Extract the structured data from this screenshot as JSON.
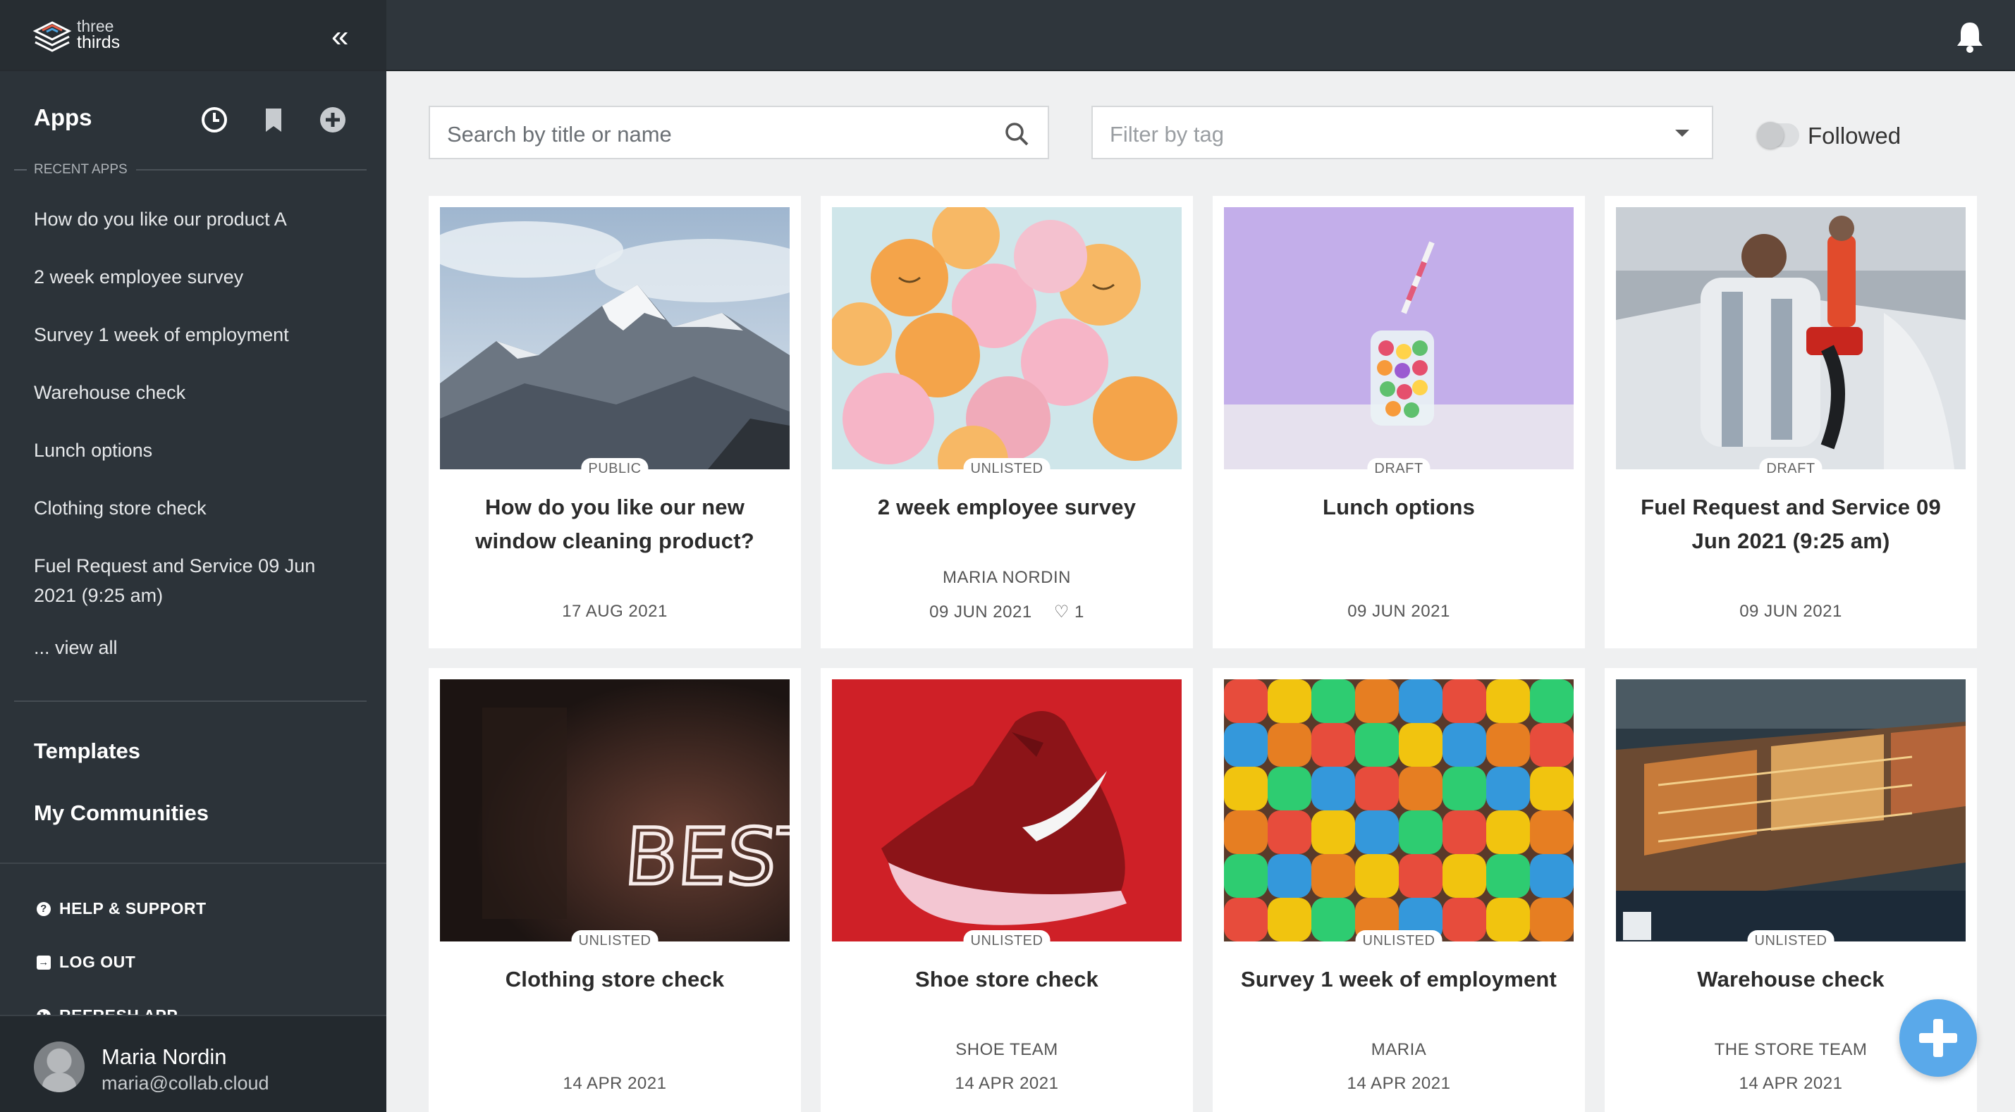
{
  "brand": {
    "line1": "three",
    "line2": "thirds"
  },
  "sidebar": {
    "apps_label": "Apps",
    "recent_label": "RECENT APPS",
    "recent": [
      "How do you like our product A",
      "2 week employee survey",
      "Survey 1 week of employment",
      "Warehouse check",
      "Lunch options",
      "Clothing store check",
      "Fuel Request and Service 09 Jun 2021 (9:25 am)"
    ],
    "view_all": "... view all",
    "templates": "Templates",
    "communities": "My Communities",
    "help": "HELP & SUPPORT",
    "logout": "LOG OUT",
    "refresh": "REFRESH APP"
  },
  "user": {
    "name": "Maria Nordin",
    "email": "maria@collab.cloud"
  },
  "filters": {
    "search_placeholder": "Search by title or name",
    "tag_placeholder": "Filter by tag",
    "followed_label": "Followed",
    "followed_on": false
  },
  "cards": [
    {
      "badge": "PUBLIC",
      "title": "How do you like our new window cleaning product?",
      "author": "",
      "date": "17 AUG 2021",
      "likes": ""
    },
    {
      "badge": "UNLISTED",
      "title": "2 week employee survey",
      "author": "MARIA NORDIN",
      "date": "09 JUN 2021",
      "likes": "1"
    },
    {
      "badge": "DRAFT",
      "title": "Lunch options",
      "author": "",
      "date": "09 JUN 2021",
      "likes": ""
    },
    {
      "badge": "DRAFT",
      "title": "Fuel Request and Service 09 Jun 2021 (9:25 am)",
      "author": "",
      "date": "09 JUN 2021",
      "likes": ""
    },
    {
      "badge": "UNLISTED",
      "title": "Clothing store check",
      "author": "",
      "date": "14 APR 2021",
      "likes": ""
    },
    {
      "badge": "UNLISTED",
      "title": "Shoe store check",
      "author": "SHOE TEAM",
      "date": "14 APR 2021",
      "likes": ""
    },
    {
      "badge": "UNLISTED",
      "title": "Survey 1 week of employment",
      "author": "MARIA",
      "date": "14 APR 2021",
      "likes": ""
    },
    {
      "badge": "UNLISTED",
      "title": "Warehouse check",
      "author": "THE STORE TEAM",
      "date": "14 APR 2021",
      "likes": ""
    }
  ],
  "neon_text": "BEST",
  "colors": {
    "sidebar": "#2c3339",
    "topbar": "#2f363c",
    "fab": "#5aa9ea",
    "content_bg": "#eff0f1"
  }
}
